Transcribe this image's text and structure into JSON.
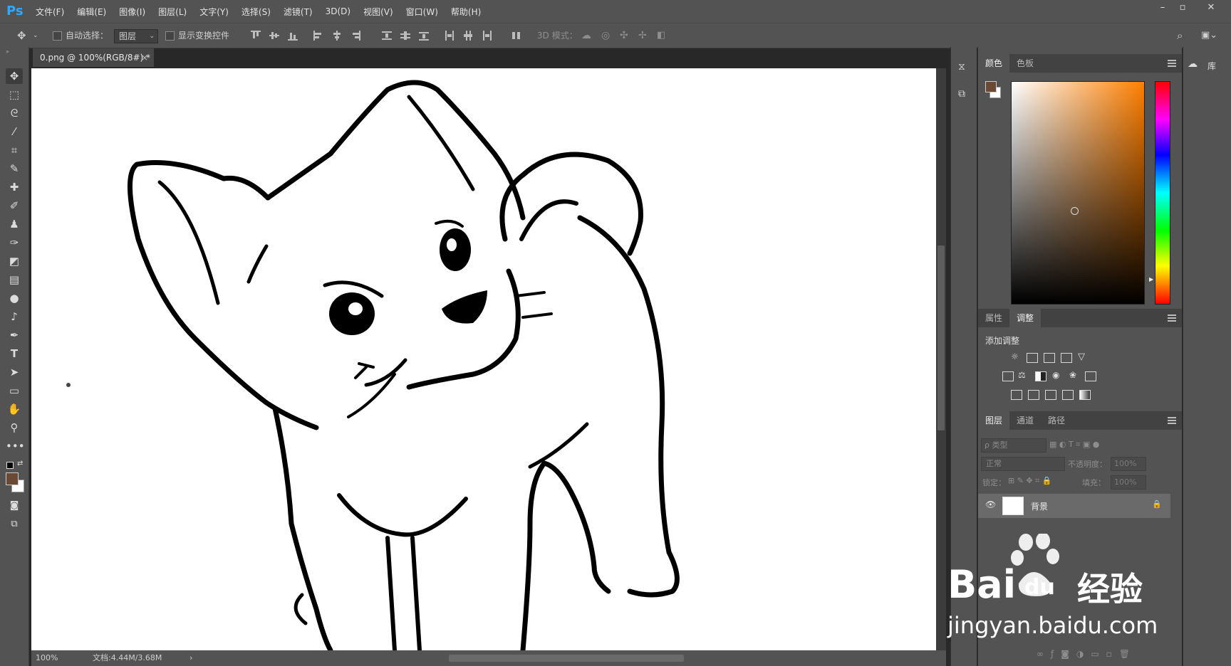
{
  "app": {
    "logo": "Ps"
  },
  "menu": [
    "文件(F)",
    "编辑(E)",
    "图像(I)",
    "图层(L)",
    "文字(Y)",
    "选择(S)",
    "滤镜(T)",
    "3D(D)",
    "视图(V)",
    "窗口(W)",
    "帮助(H)"
  ],
  "window_controls": {
    "minimize": "–",
    "maximize": "▫",
    "close": "✕"
  },
  "options": {
    "auto_select_label": "自动选择：",
    "auto_select_value": "图层",
    "show_transform_label": "显示变换控件",
    "mode_3d_label": "3D 模式："
  },
  "document": {
    "tab_title": "0.png @ 100%(RGB/8#) *",
    "tab_close": "×",
    "zoom": "100%",
    "doc_info": "文档:4.44M/3.68M",
    "status_arrow": "›"
  },
  "panels": {
    "color_tabs": [
      "颜色",
      "色板"
    ],
    "foreground_color": "#6b4a35",
    "background_color": "#ffffff",
    "picker_hue": "#ff7f00",
    "prop_tabs": [
      "属性",
      "调整"
    ],
    "add_adjustment": "添加调整",
    "layer_tabs": [
      "图层",
      "通道",
      "路径"
    ],
    "filter_kind": "ρ 类型",
    "blend_mode": "正常",
    "opacity_label": "不透明度：",
    "opacity_value": "100%",
    "lock_label": "锁定：",
    "fill_label": "填充：",
    "fill_value": "100%",
    "layer_name": "背景"
  },
  "library": {
    "label": "库"
  },
  "watermark": {
    "brand": "Bai",
    "brand_cn": "经验",
    "url": "jingyan.baidu.com",
    "paw_text": "du"
  },
  "icons": {
    "move": "move-icon",
    "marquee": "marquee-icon",
    "lasso": "lasso-icon"
  }
}
